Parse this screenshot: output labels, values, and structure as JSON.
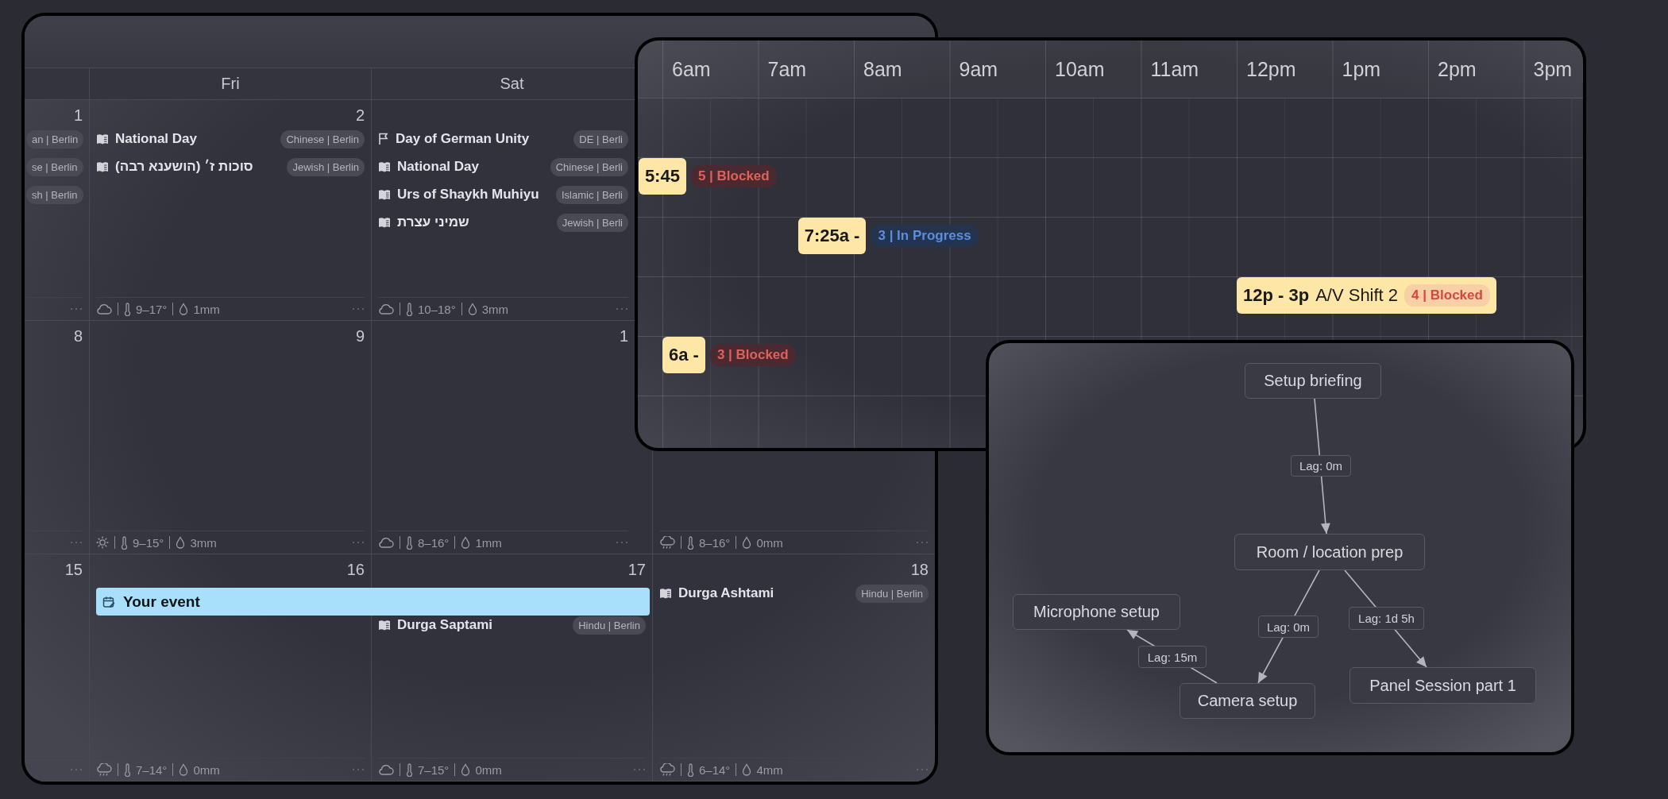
{
  "calendar": {
    "day_headers": [
      "Fri",
      "Sat"
    ],
    "weeks": [
      {
        "days": [
          {
            "date": "1",
            "events": [
              {
                "tag": "an | Berlin"
              },
              {
                "tag": "se | Berlin"
              },
              {
                "tag": "sh | Berlin"
              }
            ]
          },
          {
            "date": "2",
            "events": [
              {
                "kind": "book",
                "title": "National Day",
                "tag": "Chinese | Berlin"
              },
              {
                "kind": "book",
                "title": "סוכות ז׳ (הושענא רבה)",
                "tag": "Jewish | Berlin"
              }
            ],
            "weather": {
              "kind": "cloudy",
              "temperature": "9–17°",
              "rain": "1mm"
            }
          },
          {
            "events": [
              {
                "kind": "flag",
                "title": "Day of German Unity",
                "tag": "DE | Berli"
              },
              {
                "kind": "book",
                "title": "National Day",
                "tag": "Chinese | Berli"
              },
              {
                "kind": "book",
                "title": "Urs of Shaykh Muhiyu",
                "tag": "Islamic | Berli"
              },
              {
                "kind": "book",
                "title": "שמיני עצרת",
                "tag": "Jewish | Berli"
              }
            ],
            "weather": {
              "kind": "cloudy",
              "temperature": "10–18°",
              "rain": "3mm"
            }
          }
        ]
      },
      {
        "days": [
          {
            "date": "8"
          },
          {
            "date": "9",
            "weather": {
              "kind": "sunny",
              "temperature": "9–15°",
              "rain": "3mm"
            }
          },
          {
            "date": "1",
            "weather": {
              "kind": "cloudy",
              "temperature": "8–16°",
              "rain": "1mm"
            }
          },
          {
            "weather": {
              "kind": "rain",
              "temperature": "8–16°",
              "rain": "0mm"
            }
          }
        ]
      },
      {
        "days": [
          {
            "date": "15"
          },
          {
            "date": "16",
            "events": [
              {
                "kind": "span",
                "title": "Your event"
              }
            ],
            "weather": {
              "kind": "rain",
              "temperature": "7–14°",
              "rain": "0mm"
            }
          },
          {
            "date": "17",
            "events": [
              {
                "kind": "book",
                "title": "Durga Saptami",
                "tag": "Hindu | Berlin"
              }
            ],
            "weather": {
              "kind": "cloudy",
              "temperature": "7–15°",
              "rain": "0mm"
            }
          },
          {
            "date": "18",
            "events": [
              {
                "kind": "book",
                "title": "Durga Ashtami",
                "tag": "Hindu | Berlin"
              }
            ],
            "weather": {
              "kind": "rain",
              "temperature": "6–14°",
              "rain": "4mm"
            }
          }
        ]
      }
    ]
  },
  "timeline": {
    "hours": [
      "6am",
      "7am",
      "8am",
      "9am",
      "10am",
      "11am",
      "12pm",
      "1pm",
      "2pm",
      "3pm"
    ],
    "events": [
      {
        "time": "5:45",
        "status": {
          "text": "5 | Blocked",
          "kind": "blocked"
        },
        "overflowing": true
      },
      {
        "time": "7:25a -",
        "status": {
          "text": "3 | In Progress",
          "kind": "in_progress"
        },
        "overflowing": true
      },
      {
        "time": "12p - 3p",
        "title": "A/V Shift 2",
        "status": {
          "text": "4 | Blocked",
          "kind": "blocked"
        },
        "overflowing": false
      },
      {
        "time": "6a -",
        "status": {
          "text": "3 | Blocked",
          "kind": "blocked"
        },
        "overflowing": true
      }
    ]
  },
  "diagram": {
    "nodes": [
      {
        "label": "Setup briefing"
      },
      {
        "label": "Room / location prep"
      },
      {
        "label": "Microphone setup"
      },
      {
        "label": "Camera setup"
      },
      {
        "label": "Panel Session part 1"
      }
    ],
    "edges": [
      {
        "label": "Lag: 0m"
      },
      {
        "label": "Lag: 0m"
      },
      {
        "label": "Lag: 1d 5h"
      },
      {
        "label": "Lag: 15m"
      }
    ]
  }
}
